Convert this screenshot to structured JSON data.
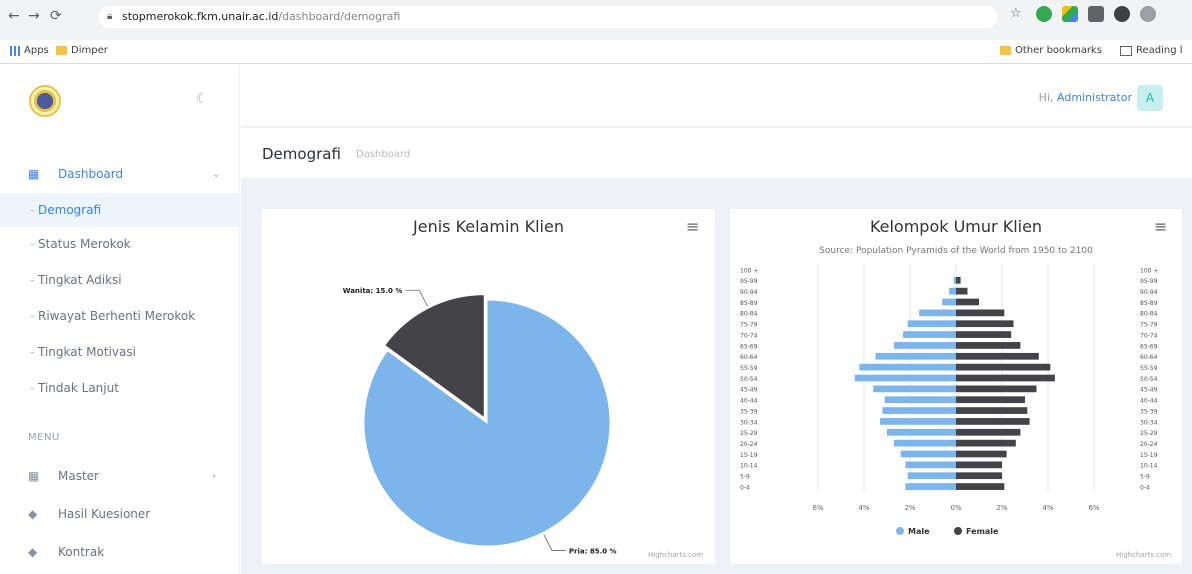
{
  "browser": {
    "url_host": "stopmerokok.fkm.unair.ac.id",
    "url_path": "/dashboard/demografi",
    "bookmarks": {
      "apps": "Apps",
      "folder": "Dimper",
      "other": "Other bookmarks",
      "reading": "Reading l"
    }
  },
  "sidebar": {
    "items": [
      {
        "label": "Dashboard"
      },
      {
        "label": "Demografi"
      },
      {
        "label": "Status Merokok"
      },
      {
        "label": "Tingkat Adiksi"
      },
      {
        "label": "Riwayat Berhenti Merokok"
      },
      {
        "label": "Tingkat Motivasi"
      },
      {
        "label": "Tindak Lanjut"
      }
    ],
    "menu_caption": "MENU",
    "menu_items": [
      {
        "label": "Master"
      },
      {
        "label": "Hasil Kuesioner"
      },
      {
        "label": "Kontrak"
      }
    ]
  },
  "header": {
    "greeting": "Hi,",
    "user": "Administrator",
    "avatar_letter": "A"
  },
  "page": {
    "title": "Demografi",
    "breadcrumb": "Dashboard"
  },
  "colors": {
    "accent": "#3b82f6",
    "male": "#7cb5ec",
    "female": "#434348"
  },
  "chart_data": [
    {
      "type": "pie",
      "title": "Jenis Kelamin Klien",
      "slices": [
        {
          "label": "Pria",
          "value": 85.0,
          "display": "Pria: 85.0 %"
        },
        {
          "label": "Wanita",
          "value": 15.0,
          "display": "Wanita: 15.0 %"
        }
      ],
      "credit": "Highcharts.com"
    },
    {
      "type": "bar",
      "title": "Kelompok Umur Klien",
      "subtitle": "Source: Population Pyramids of the World from 1950 to 2100",
      "categories": [
        "0-4",
        "5-9",
        "10-14",
        "15-19",
        "20-24",
        "25-29",
        "30-34",
        "35-39",
        "40-44",
        "45-49",
        "50-54",
        "55-59",
        "60-64",
        "65-69",
        "70-74",
        "75-79",
        "80-84",
        "85-89",
        "90-94",
        "95-99",
        "100 +"
      ],
      "series": [
        {
          "name": "Male",
          "values": [
            2.2,
            2.1,
            2.2,
            2.4,
            2.7,
            3.0,
            3.3,
            3.2,
            3.1,
            3.6,
            4.4,
            4.2,
            3.5,
            2.7,
            2.3,
            2.1,
            1.6,
            0.6,
            0.3,
            0.1,
            0.0
          ]
        },
        {
          "name": "Female",
          "values": [
            2.1,
            2.0,
            2.0,
            2.2,
            2.6,
            2.8,
            3.2,
            3.1,
            3.0,
            3.5,
            4.3,
            4.1,
            3.6,
            2.8,
            2.4,
            2.5,
            2.1,
            1.0,
            0.5,
            0.2,
            0.0
          ]
        }
      ],
      "xlim": [
        -6,
        6
      ],
      "ticks": [
        "6%",
        "4%",
        "2%",
        "0%",
        "2%",
        "4%",
        "6%"
      ],
      "credit": "Highcharts.com"
    }
  ]
}
